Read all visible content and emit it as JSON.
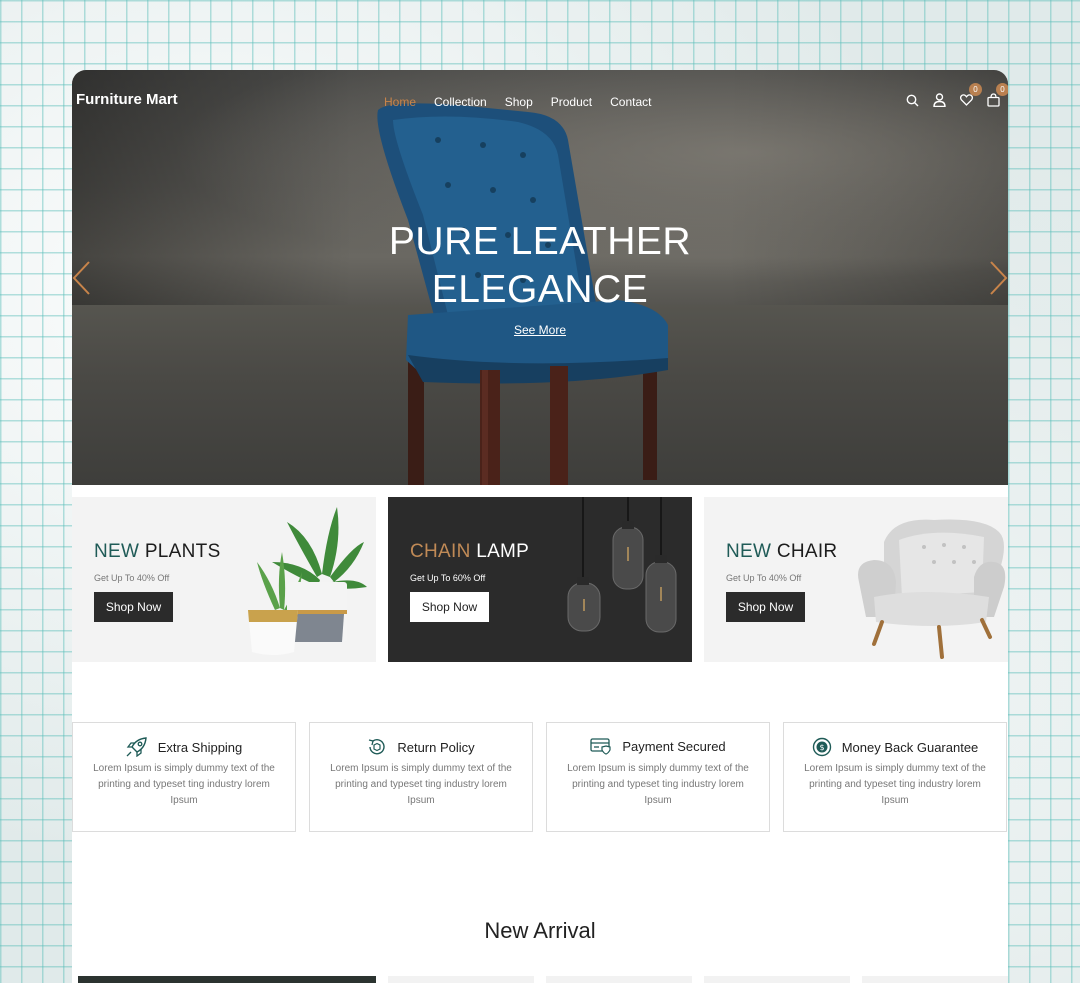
{
  "brand": "Furniture Mart",
  "nav": {
    "items": [
      {
        "label": "Home",
        "active": true
      },
      {
        "label": "Collection"
      },
      {
        "label": "Shop"
      },
      {
        "label": "Product"
      },
      {
        "label": "Contact"
      }
    ],
    "icons": [
      "search-icon",
      "user-icon",
      "heart-icon",
      "cart-icon"
    ],
    "wishlist_count": "0",
    "cart_count": "0"
  },
  "hero": {
    "title_line1": "PURE LEATHER",
    "title_line2": "ELEGANCE",
    "link": "See More"
  },
  "banners": [
    {
      "accent": "NEW",
      "rest": "PLANTS",
      "subtitle": "Get Up To 40% Off",
      "button": "Shop Now",
      "theme": "light"
    },
    {
      "accent": "CHAIN",
      "rest": "LAMP",
      "subtitle": "Get Up To 60% Off",
      "button": "Shop Now",
      "theme": "dark"
    },
    {
      "accent": "NEW",
      "rest": "CHAIR",
      "subtitle": "Get Up To 40% Off",
      "button": "Shop Now",
      "theme": "light"
    }
  ],
  "features": [
    {
      "title": "Extra Shipping",
      "icon": "rocket-icon",
      "desc": "Lorem Ipsum is simply dummy text of the printing and typeset ting industry lorem Ipsum"
    },
    {
      "title": "Return Policy",
      "icon": "return-box-icon",
      "desc": "Lorem Ipsum is simply dummy text of the printing and typeset ting industry lorem Ipsum"
    },
    {
      "title": "Payment Secured",
      "icon": "card-shield-icon",
      "desc": "Lorem Ipsum is simply dummy text of the printing and typeset ting industry lorem Ipsum"
    },
    {
      "title": "Money Back Guarantee",
      "icon": "money-back-icon",
      "desc": "Lorem Ipsum is simply dummy text of the printing and typeset ting industry lorem Ipsum"
    }
  ],
  "section_title": "New Arrival",
  "colors": {
    "accent_gold": "#c8844a",
    "accent_teal": "#1f5b57",
    "dark": "#2b2b2b"
  }
}
